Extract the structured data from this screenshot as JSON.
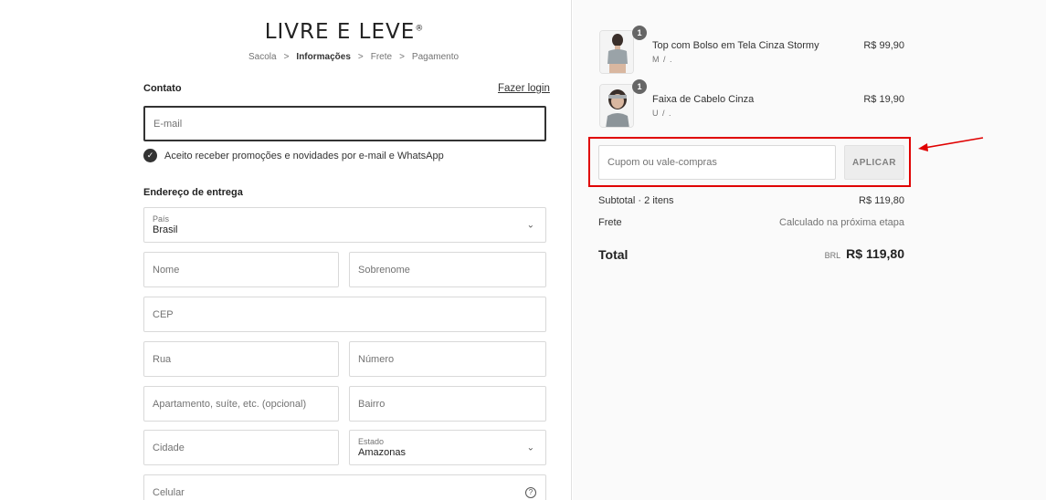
{
  "brand": {
    "logo_text": "LIVRE E LEVE",
    "logo_mark": "®"
  },
  "breadcrumb": {
    "steps": [
      "Sacola",
      "Informações",
      "Frete",
      "Pagamento"
    ],
    "separator": ">"
  },
  "contact": {
    "title": "Contato",
    "login_link": "Fazer login",
    "email_placeholder": "E-mail",
    "marketing_opt_in": "Aceito receber promoções e novidades por e-mail e WhatsApp",
    "marketing_checked": true
  },
  "shipping": {
    "title": "Endereço de entrega",
    "country_label": "País",
    "country_value": "Brasil",
    "first_name_placeholder": "Nome",
    "last_name_placeholder": "Sobrenome",
    "cep_placeholder": "CEP",
    "street_placeholder": "Rua",
    "number_placeholder": "Número",
    "apartment_placeholder": "Apartamento, suíte, etc. (opcional)",
    "neighborhood_placeholder": "Bairro",
    "city_placeholder": "Cidade",
    "state_label": "Estado",
    "state_value": "Amazonas",
    "phone_placeholder": "Celular",
    "help_glyph": "?"
  },
  "cart": {
    "items": [
      {
        "name": "Top com Bolso em Tela Cinza Stormy",
        "variant": "M / .",
        "price": "R$ 99,90",
        "quantity": "1"
      },
      {
        "name": "Faixa de Cabelo Cinza",
        "variant": "U / .",
        "price": "R$ 19,90",
        "quantity": "1"
      }
    ],
    "coupon_placeholder": "Cupom ou vale-compras",
    "coupon_button": "APLICAR",
    "subtotal_label": "Subtotal · 2 itens",
    "subtotal_value": "R$ 119,80",
    "shipping_label": "Frete",
    "shipping_value": "Calculado na próxima etapa",
    "total_label": "Total",
    "total_currency": "BRL",
    "total_value": "R$ 119,80"
  },
  "annotation": {
    "highlight_color": "#e00000"
  }
}
